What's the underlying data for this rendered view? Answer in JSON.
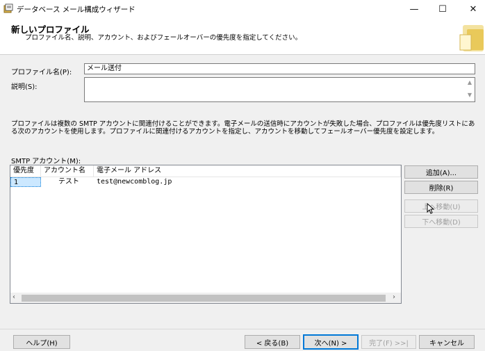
{
  "window": {
    "title": "データベース メール構成ウィザード",
    "minimize_glyph": "—",
    "maximize_glyph": "☐",
    "close_glyph": "✕"
  },
  "header": {
    "title": "新しいプロファイル",
    "description": "プロファイル名、説明、アカウント、およびフェールオーバーの優先度を指定してください。"
  },
  "form": {
    "profile_name_label": "プロファイル名(P):",
    "profile_name_value": "メール送付",
    "description_label": "説明(S):",
    "description_value": "",
    "info_text": "プロファイルは複数の SMTP アカウントに関連付けることができます。電子メールの送信時にアカウントが失敗した場合、プロファイルは優先度リストにある次のアカウントを使用します。プロファイルに関連付けるアカウントを指定し、アカウントを移動してフェールオーバー優先度を設定します。",
    "smtp_label": "SMTP アカウント(M):"
  },
  "accounts": {
    "columns": [
      "優先度",
      "アカウント名",
      "電子メール アドレス"
    ],
    "rows": [
      {
        "priority": "1",
        "name": "テスト",
        "email": "test@newcomblog.jp"
      }
    ]
  },
  "side_buttons": {
    "add": "追加(A)...",
    "remove": "削除(R)",
    "move_up": "上へ移動(U)",
    "move_down": "下へ移動(D)"
  },
  "footer": {
    "help": "ヘルプ(H)",
    "back": "< 戻る(B)",
    "next": "次へ(N) >",
    "finish": "完了(F) >>|",
    "cancel": "キャンセル"
  },
  "colors": {
    "accent": "#0078d7",
    "selection": "#cce8ff"
  }
}
